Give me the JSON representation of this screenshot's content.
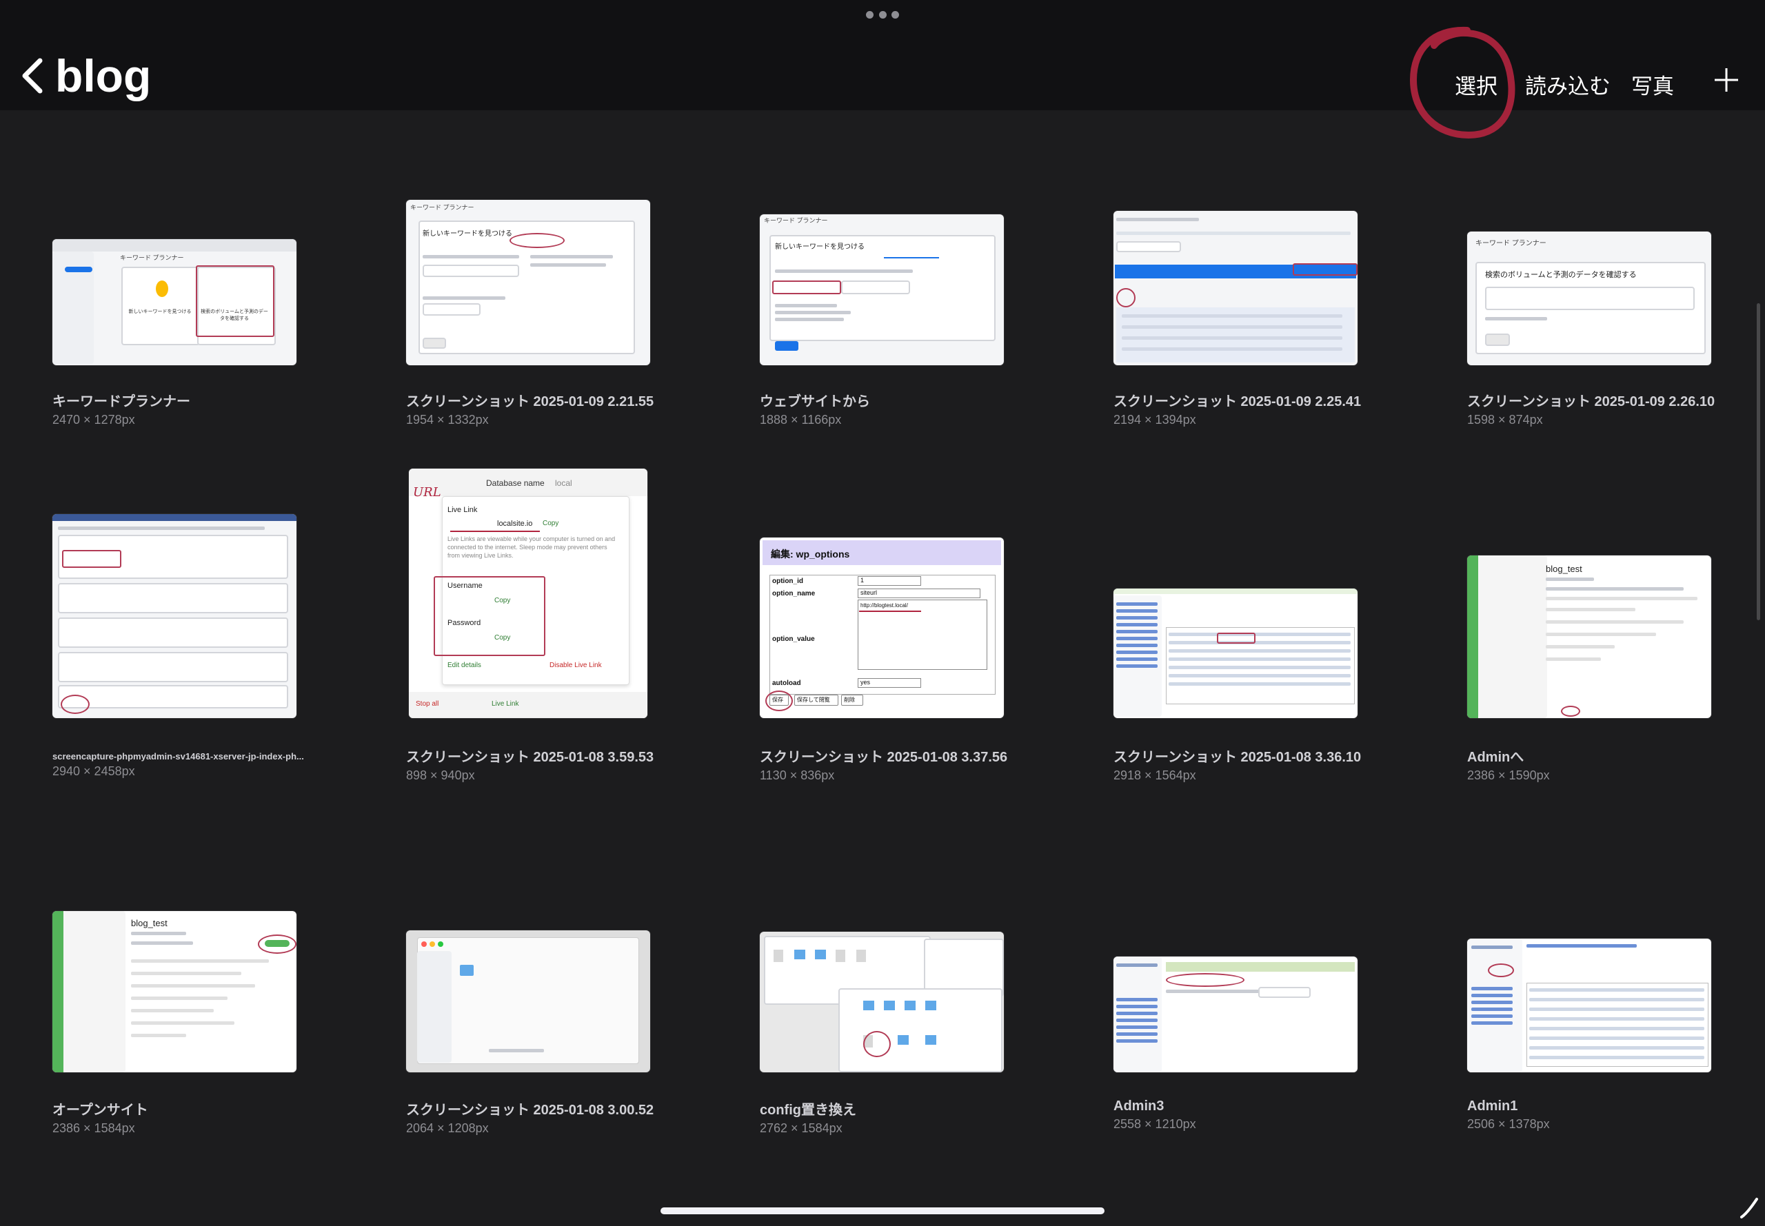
{
  "header": {
    "back_label": "blog",
    "actions": {
      "select": "選択",
      "import": "読み込む",
      "photo": "写真"
    }
  },
  "items": [
    {
      "name": "キーワードプランナー",
      "size": "2470 × 1278px"
    },
    {
      "name": "スクリーンショット 2025-01-09 2.21.55",
      "size": "1954 × 1332px"
    },
    {
      "name": "ウェブサイトから",
      "size": "1888 × 1166px"
    },
    {
      "name": "スクリーンショット 2025-01-09 2.25.41",
      "size": "2194 × 1394px"
    },
    {
      "name": "スクリーンショット 2025-01-09 2.26.10",
      "size": "1598 × 874px"
    },
    {
      "name": "screencapture-phpmyadmin-sv14681-xserver-jp-index-ph...",
      "size": "2940 × 2458px"
    },
    {
      "name": "スクリーンショット 2025-01-08 3.59.53",
      "size": "898 × 940px"
    },
    {
      "name": "スクリーンショット 2025-01-08 3.37.56",
      "size": "1130 × 836px"
    },
    {
      "name": "スクリーンショット 2025-01-08 3.36.10",
      "size": "2918 × 1564px"
    },
    {
      "name": "Adminへ",
      "size": "2386 × 1590px"
    },
    {
      "name": "オープンサイト",
      "size": "2386 × 1584px"
    },
    {
      "name": "スクリーンショット 2025-01-08 3.00.52",
      "size": "2064 × 1208px"
    },
    {
      "name": "config置き換え",
      "size": "2762 × 1584px"
    },
    {
      "name": "Admin3",
      "size": "2558 × 1210px"
    },
    {
      "name": "Admin1",
      "size": "2506 × 1378px"
    }
  ],
  "thumb_text": {
    "t1": {
      "title": "キーワード プランナー",
      "opt1": "新しいキーワードを見つける",
      "opt2": "検索のボリュームと予測のデータを確認する"
    },
    "t2": {
      "title": "キーワード プランナー",
      "heading": "新しいキーワードを見つける"
    },
    "t3": {
      "title": "キーワード プランナー",
      "heading": "新しいキーワードを見つける"
    },
    "t5": {
      "title": "キーワード プランナー",
      "heading": "検索のボリュームと予測のデータを確認する"
    },
    "t7": {
      "db_label": "Database name",
      "db_value": "local",
      "live_link": "Live Link",
      "site": "localsite.io",
      "copy": "Copy",
      "desc": "Live Links are viewable while your computer is turned on and connected to the internet. Sleep mode may prevent others from viewing Live Links.",
      "username": "Username",
      "password": "Password",
      "edit": "Edit details",
      "disable": "Disable Live Link",
      "stop": "Stop all",
      "live": "Live Link",
      "annotation": "URL"
    },
    "t8": {
      "title": "編集: wp_options",
      "f1": "option_id",
      "v1": "1",
      "f2": "option_name",
      "v2": "siteurl",
      "f3": "option_value",
      "v3": "http://blogtest.local/",
      "f4": "autoload",
      "v4": "yes",
      "b1": "保存",
      "b2": "保存して閉覧",
      "b3": "削除"
    },
    "t10": {
      "title": "blog_test"
    },
    "t11": {
      "title": "blog_test"
    }
  }
}
